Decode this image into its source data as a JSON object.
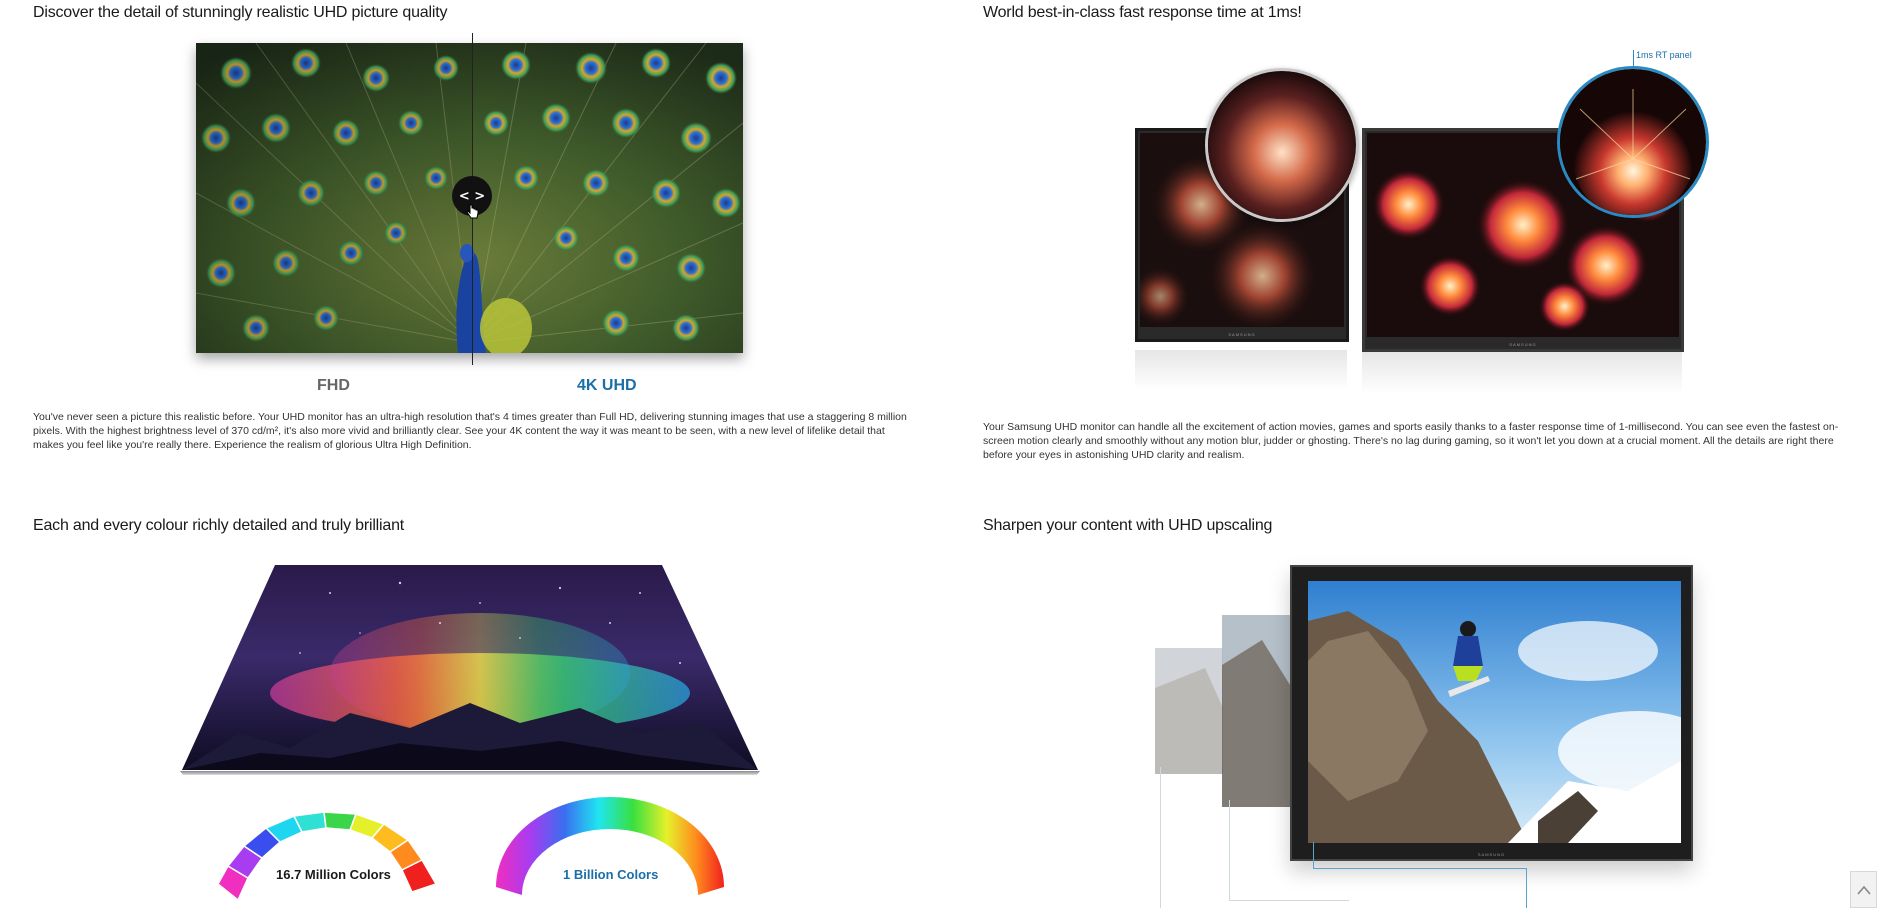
{
  "sections": [
    {
      "title": "Discover the detail of stunningly realistic UHD picture quality",
      "compare": {
        "left_label": "FHD",
        "right_label": "4K UHD",
        "slider_position": 0.5
      },
      "body": "You've never seen a picture this realistic before. Your UHD monitor has an ultra-high resolution that's 4 times greater than Full HD, delivering stunning images that use a staggering 8 million pixels. With the highest brightness level of 370 cd/m², it's also more vivid and brilliantly clear. See your 4K content the way it was meant to be seen, with a new level of lifelike detail that makes you feel like you're really there. Experience the realism of glorious Ultra High Definition."
    },
    {
      "title": "World best-in-class fast response time at 1ms!",
      "callout": "1ms RT panel",
      "monitor_brand": "SAMSUNG",
      "body": "Your Samsung UHD monitor can handle all the excitement of action movies, games and sports easily thanks to a faster response time of 1-millisecond. You can see even the fastest on-screen motion clearly and smoothly without any motion blur, judder or ghosting. There's no lag during gaming, so it won't let you down at a crucial moment. All the details are right there before your eyes in astonishing UHD clarity and realism."
    },
    {
      "title": "Each and every colour richly detailed and truly brilliant",
      "arcs": [
        {
          "label": "16.7 Million Colors",
          "color": "#1a1a1a"
        },
        {
          "label": "1 Billion Colors",
          "color": "#1a6fa8"
        }
      ]
    },
    {
      "title": "Sharpen your content with UHD upscaling",
      "monitor_brand": "SAMSUNG"
    }
  ],
  "accent_color": "#1a6fa8",
  "icons": {
    "slider": "compare-slider-icon",
    "scroll": "chevron-up-icon"
  }
}
